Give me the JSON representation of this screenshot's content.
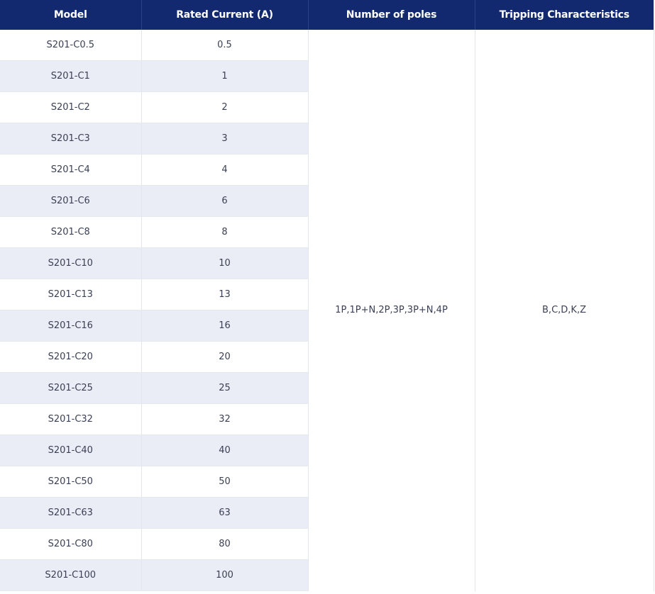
{
  "table": {
    "headers": [
      "Model",
      "Rated Current (A)",
      "Number of poles",
      "Tripping Characteristics"
    ],
    "rows": [
      {
        "model": "S201-C0.5",
        "current": "0.5"
      },
      {
        "model": "S201-C1",
        "current": "1"
      },
      {
        "model": "S201-C2",
        "current": "2"
      },
      {
        "model": "S201-C3",
        "current": "3"
      },
      {
        "model": "S201-C4",
        "current": "4"
      },
      {
        "model": "S201-C6",
        "current": "6"
      },
      {
        "model": "S201-C8",
        "current": "8"
      },
      {
        "model": "S201-C10",
        "current": "10"
      },
      {
        "model": "S201-C13",
        "current": "13"
      },
      {
        "model": "S201-C16",
        "current": "16"
      },
      {
        "model": "S201-C20",
        "current": "20"
      },
      {
        "model": "S201-C25",
        "current": "25"
      },
      {
        "model": "S201-C32",
        "current": "32"
      },
      {
        "model": "S201-C40",
        "current": "40"
      },
      {
        "model": "S201-C50",
        "current": "50"
      },
      {
        "model": "S201-C63",
        "current": "63"
      },
      {
        "model": "S201-C80",
        "current": "80"
      },
      {
        "model": "S201-C100",
        "current": "100"
      }
    ],
    "poles": "1P,1P+N,2P,3P,3P+N,4P",
    "tripping": "B,C,D,K,Z"
  },
  "colors": {
    "header_bg": "#13296f",
    "header_text": "#ffffff",
    "stripe": "#eaedf5",
    "text": "#3a3f55"
  }
}
